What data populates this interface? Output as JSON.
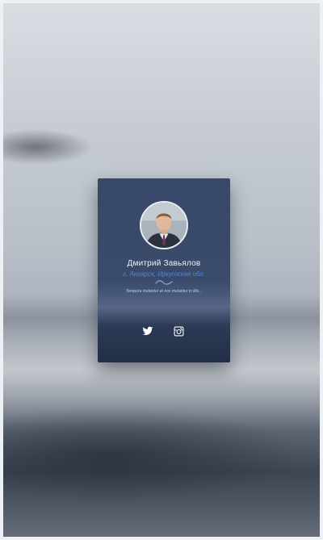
{
  "profile": {
    "name": "Дмитрий Завьялов",
    "location": "г. Ангарск, Иркутская обл.",
    "tagline": "Tempora mutantur et nos mutantur in illis..."
  },
  "social": {
    "twitter_icon": "twitter-icon",
    "instagram_icon": "instagram-icon"
  },
  "colors": {
    "card_bg": "#384867",
    "accent": "#4f86d6",
    "text": "#eef1f6"
  }
}
